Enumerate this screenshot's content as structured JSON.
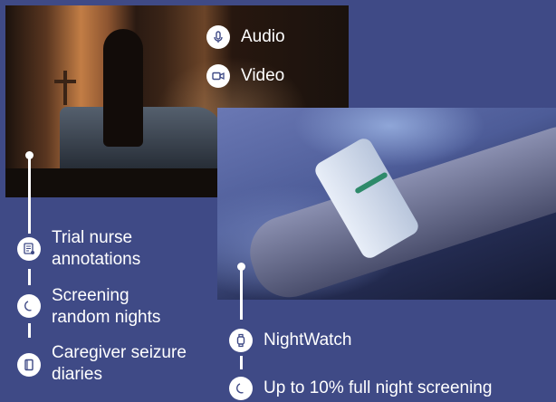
{
  "media": {
    "audio_label": "Audio",
    "video_label": "Video"
  },
  "left_list": [
    {
      "line1": "Trial nurse",
      "line2": "annotations",
      "icon": "annotation-icon"
    },
    {
      "line1": "Screening",
      "line2": "random nights",
      "icon": "moon-icon"
    },
    {
      "line1": "Caregiver seizure",
      "line2": "diaries",
      "icon": "diary-icon"
    }
  ],
  "right_list": [
    {
      "label": "NightWatch",
      "icon": "watch-icon"
    },
    {
      "label": "Up to 10% full night screening",
      "icon": "moon-icon"
    }
  ],
  "colors": {
    "background": "#3f4a86",
    "badge_icon": "#3f4a86",
    "text": "#ffffff"
  }
}
